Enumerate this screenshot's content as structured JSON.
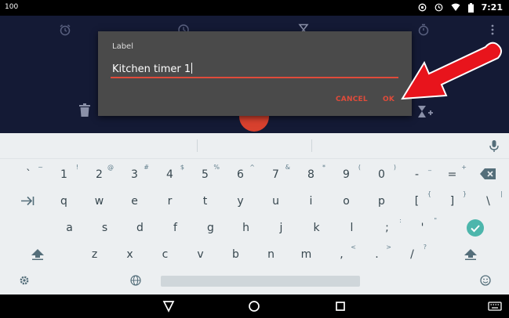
{
  "status": {
    "battery_text": "100",
    "time": "7:21"
  },
  "dialog": {
    "label": "Label",
    "input_value": "Kitchen timer 1",
    "cancel_label": "CANCEL",
    "ok_label": "OK"
  },
  "keyboard": {
    "rows": [
      [
        {
          "main": "`",
          "sub": "~"
        },
        {
          "main": "1",
          "sub": "!"
        },
        {
          "main": "2",
          "sub": "@"
        },
        {
          "main": "3",
          "sub": "#"
        },
        {
          "main": "4",
          "sub": "$"
        },
        {
          "main": "5",
          "sub": "%"
        },
        {
          "main": "6",
          "sub": "^"
        },
        {
          "main": "7",
          "sub": "&"
        },
        {
          "main": "8",
          "sub": "*"
        },
        {
          "main": "9",
          "sub": "("
        },
        {
          "main": "0",
          "sub": ")"
        },
        {
          "main": "-",
          "sub": "_"
        },
        {
          "main": "=",
          "sub": "+"
        }
      ],
      [
        {
          "main": "q"
        },
        {
          "main": "w"
        },
        {
          "main": "e"
        },
        {
          "main": "r"
        },
        {
          "main": "t"
        },
        {
          "main": "y"
        },
        {
          "main": "u"
        },
        {
          "main": "i"
        },
        {
          "main": "o"
        },
        {
          "main": "p"
        },
        {
          "main": "[",
          "sub": "{"
        },
        {
          "main": "]",
          "sub": "}"
        },
        {
          "main": "\\",
          "sub": "|"
        }
      ],
      [
        {
          "main": "a"
        },
        {
          "main": "s"
        },
        {
          "main": "d"
        },
        {
          "main": "f"
        },
        {
          "main": "g"
        },
        {
          "main": "h"
        },
        {
          "main": "j"
        },
        {
          "main": "k"
        },
        {
          "main": "l"
        },
        {
          "main": ";",
          "sub": ":"
        },
        {
          "main": "'",
          "sub": "\""
        }
      ],
      [
        {
          "main": "z"
        },
        {
          "main": "x"
        },
        {
          "main": "c"
        },
        {
          "main": "v"
        },
        {
          "main": "b"
        },
        {
          "main": "n"
        },
        {
          "main": "m"
        },
        {
          "main": ",",
          "sub": "<"
        },
        {
          "main": ".",
          "sub": ">"
        },
        {
          "main": "/",
          "sub": "?"
        }
      ]
    ]
  },
  "colors": {
    "accent": "#e04b3a",
    "check": "#4db6ac",
    "app_bg": "#141a35",
    "dialog_bg": "#4a4a4a",
    "keyboard_bg": "#eceff1"
  },
  "icons": {
    "status": [
      "wifi-icon",
      "alarm-icon",
      "battery-icon"
    ],
    "tabs": [
      "alarm-tab-icon",
      "clock-tab-icon",
      "timer-tab-icon",
      "stopwatch-tab-icon",
      "overflow-menu-icon"
    ],
    "keyboard": [
      "mic-icon",
      "backspace-icon",
      "tab-icon",
      "shift-icon",
      "done-check-icon",
      "settings-icon",
      "globe-icon",
      "emoji-icon"
    ],
    "nav": [
      "back-icon",
      "home-icon",
      "recents-icon",
      "keyboard-switch-icon"
    ]
  }
}
